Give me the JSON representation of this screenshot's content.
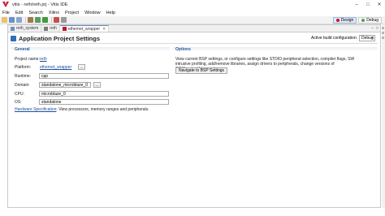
{
  "window": {
    "title": "vitis - reth/reth.prj - Vitis IDE",
    "minimize": "–",
    "maximize": "□",
    "close": "✕"
  },
  "menu": [
    "File",
    "Edit",
    "Search",
    "Xilinx",
    "Project",
    "Window",
    "Help"
  ],
  "perspectives": {
    "design": "Design",
    "debug": "Debug"
  },
  "tabs": [
    {
      "label": "reth_system"
    },
    {
      "label": "reth"
    },
    {
      "label": "ethernet_wrapper"
    }
  ],
  "tab_controls": {
    "minimize": "–",
    "maximize": "□"
  },
  "editor": {
    "title": "Application Project Settings",
    "build_config_label": "Active build configuration:",
    "build_config_value": "Debug"
  },
  "general": {
    "title": "General",
    "project_name_label": "Project name:",
    "project_name_value": "reth",
    "platform_label": "Platform:",
    "platform_value": "ethernet_wrapper",
    "runtime_label": "Runtime:",
    "runtime_value": "cpp",
    "domain_label": "Domain:",
    "domain_value": "standalone_microblaze_0",
    "cpu_label": "CPU:",
    "cpu_value": "microblaze_0",
    "os_label": "OS:",
    "os_value": "standalone",
    "dots": "...",
    "hw_spec_link": "Hardware Specification",
    "hw_spec_text": ": View processors, memory ranges and peripherals."
  },
  "options": {
    "title": "Options",
    "description": "View current BSP settings, or configure settings like STDIO peripheral selection, compiler flags, SW intrusive profiling, add/remove libraries, assign drivers to peripherals, change versions of OS/libraries/drivers etc.",
    "nav_button": "Navigate to BSP Settings"
  }
}
